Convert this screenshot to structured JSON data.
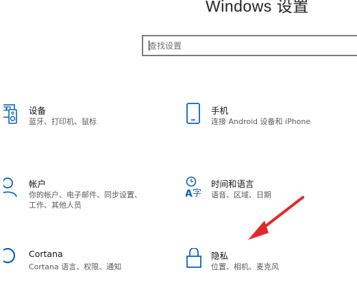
{
  "header": {
    "title": "Windows 设置"
  },
  "search": {
    "placeholder": "查找设置"
  },
  "tiles": [
    {
      "name": "设备",
      "desc": "蓝牙、打印机、鼠标",
      "icon": "devices-icon"
    },
    {
      "name": "手机",
      "desc": "连接 Android 设备和 iPhone",
      "icon": "phone-icon"
    },
    {
      "name": "帐户",
      "desc": "你的帐户、电子邮件、同步设置、工作、其他人员",
      "icon": "account-icon"
    },
    {
      "name": "时间和语言",
      "desc": "语音、区域、日期",
      "icon": "time-language-icon"
    },
    {
      "name": "Cortana",
      "desc": "Cortana 语言、权限、通知",
      "icon": "cortana-icon"
    },
    {
      "name": "隐私",
      "desc": "位置、相机、麦克风",
      "icon": "lock-icon"
    }
  ],
  "annotation": {
    "arrow_color": "#e02a2a",
    "icon": "red-arrow-annotation"
  },
  "colors": {
    "accent": "#0a64b6",
    "text": "#111111",
    "subtext": "#5a5a5a"
  }
}
